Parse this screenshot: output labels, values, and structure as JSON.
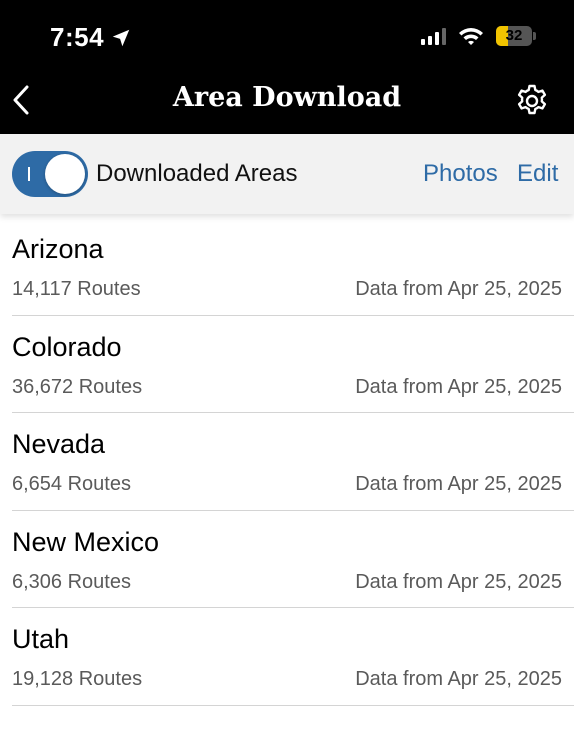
{
  "status_bar": {
    "time": "7:54",
    "battery_level": "32",
    "battery_fraction": 0.32,
    "battery_color": "#f2c400"
  },
  "nav": {
    "title": "Area Download",
    "back_icon": "chevron-left-icon",
    "settings_icon": "gear-icon"
  },
  "toolbar": {
    "toggle_label": "Downloaded Areas",
    "toggle_on": true,
    "photos_label": "Photos",
    "edit_label": "Edit",
    "accent_color": "#2e6ba6"
  },
  "areas": [
    {
      "name": "Arizona",
      "routes": "14,117 Routes",
      "date": "Data from Apr 25, 2025"
    },
    {
      "name": "Colorado",
      "routes": "36,672 Routes",
      "date": "Data from Apr 25, 2025"
    },
    {
      "name": "Nevada",
      "routes": "6,654 Routes",
      "date": "Data from Apr 25, 2025"
    },
    {
      "name": "New Mexico",
      "routes": "6,306 Routes",
      "date": "Data from Apr 25, 2025"
    },
    {
      "name": "Utah",
      "routes": "19,128 Routes",
      "date": "Data from Apr 25, 2025"
    }
  ]
}
